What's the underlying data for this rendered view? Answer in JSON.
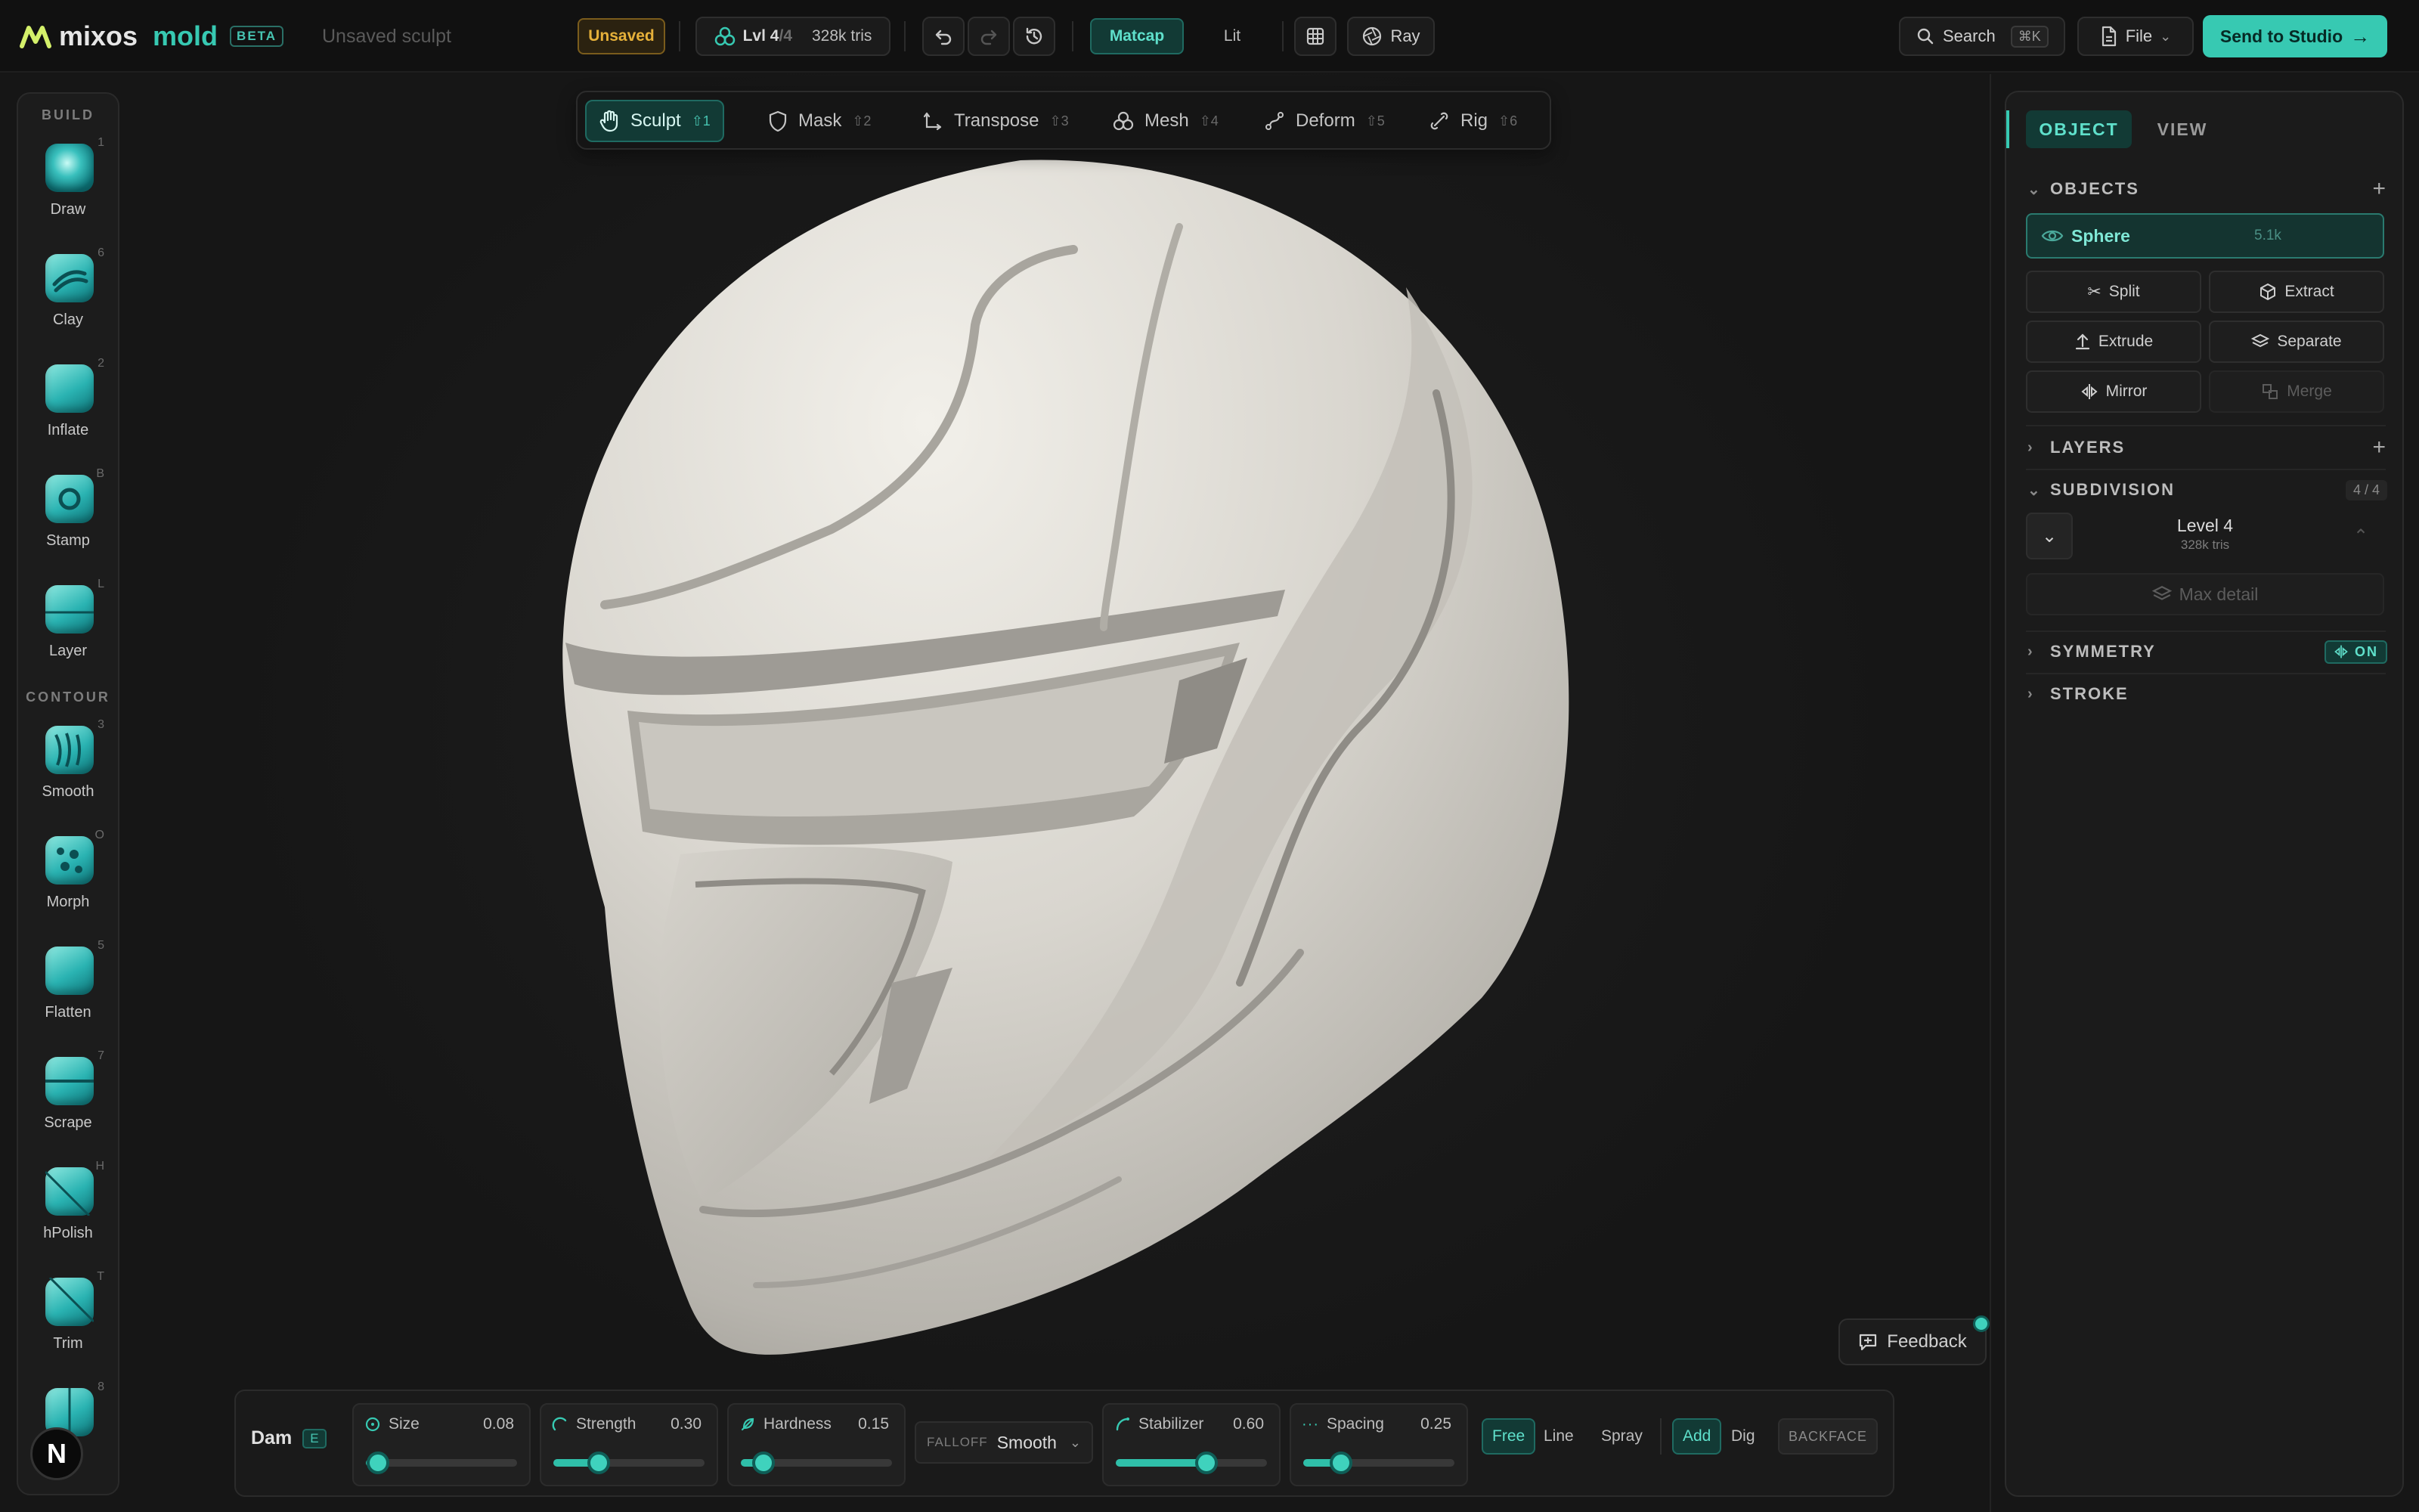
{
  "header": {
    "brand": "mixos",
    "app": "mold",
    "beta": "BETA",
    "doc_title": "Unsaved sculpt",
    "status": "Unsaved",
    "level_label": "Lvl",
    "level_current": "4",
    "level_total": "/4",
    "tris": "328k tris",
    "shading": {
      "active": "Matcap",
      "other": "Lit"
    },
    "render": "Ray",
    "search": {
      "label": "Search",
      "shortcut": "⌘K"
    },
    "file": "File",
    "send": "Send to Studio"
  },
  "modes": [
    {
      "label": "Sculpt",
      "key": "⇧1",
      "icon": "hand-icon"
    },
    {
      "label": "Mask",
      "key": "⇧2",
      "icon": "shield-icon"
    },
    {
      "label": "Transpose",
      "key": "⇧3",
      "icon": "transpose-icon"
    },
    {
      "label": "Mesh",
      "key": "⇧4",
      "icon": "mesh-icon"
    },
    {
      "label": "Deform",
      "key": "⇧5",
      "icon": "deform-icon"
    },
    {
      "label": "Rig",
      "key": "⇧6",
      "icon": "bone-icon"
    }
  ],
  "toolbar": {
    "section_build": "BUILD",
    "section_contour": "CONTOUR",
    "tools": [
      {
        "label": "Draw",
        "key": "1"
      },
      {
        "label": "Clay",
        "key": "6"
      },
      {
        "label": "Inflate",
        "key": "2"
      },
      {
        "label": "Stamp",
        "key": "B"
      },
      {
        "label": "Layer",
        "key": "L"
      },
      {
        "label": "Smooth",
        "key": "3"
      },
      {
        "label": "Morph",
        "key": "O"
      },
      {
        "label": "Flatten",
        "key": "5"
      },
      {
        "label": "Scrape",
        "key": "7"
      },
      {
        "label": "hPolish",
        "key": "H"
      },
      {
        "label": "Trim",
        "key": "T"
      },
      {
        "label": "",
        "key": "8"
      }
    ]
  },
  "panel": {
    "tabs": {
      "object": "OBJECT",
      "view": "VIEW"
    },
    "objects": {
      "title": "OBJECTS",
      "item": {
        "name": "Sphere",
        "count": "5.1k"
      },
      "actions": {
        "split": "Split",
        "extract": "Extract",
        "extrude": "Extrude",
        "separate": "Separate",
        "mirror": "Mirror",
        "merge": "Merge"
      }
    },
    "layers": {
      "title": "LAYERS"
    },
    "subdivision": {
      "title": "SUBDIVISION",
      "count": "4 / 4",
      "level": "Level 4",
      "tris": "328k tris",
      "max": "Max detail"
    },
    "symmetry": {
      "title": "SYMMETRY",
      "state": "ON"
    },
    "stroke": {
      "title": "STROKE"
    }
  },
  "brush": {
    "name": "Dam",
    "key": "E",
    "sliders": [
      {
        "label": "Size",
        "value": "0.08",
        "level": 0.08
      },
      {
        "label": "Strength",
        "value": "0.30",
        "level": 0.3
      },
      {
        "label": "Hardness",
        "value": "0.15",
        "level": 0.15
      },
      {
        "label": "Stabilizer",
        "value": "0.60",
        "level": 0.6
      },
      {
        "label": "Spacing",
        "value": "0.25",
        "level": 0.25
      }
    ],
    "falloff": {
      "label": "FALLOFF",
      "value": "Smooth"
    },
    "stroke_modes": [
      "Free",
      "Line",
      "Spray"
    ],
    "direction": [
      "Add",
      "Dig"
    ],
    "backface": "BACKFACE"
  },
  "feedback": "Feedback",
  "colors": {
    "accent": "#37c9b2",
    "warning": "#e6b13a",
    "model": "#dcd9d2"
  }
}
